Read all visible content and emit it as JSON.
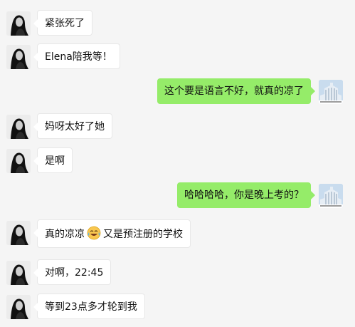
{
  "messages": [
    {
      "side": "left",
      "text": "紧张死了"
    },
    {
      "side": "left",
      "text": "Elena陪我等！"
    },
    {
      "side": "right",
      "text": "这个要是语言不好，就真的凉了"
    },
    {
      "side": "left",
      "text": "妈呀太好了她"
    },
    {
      "side": "left",
      "text": "是啊"
    },
    {
      "side": "right",
      "text": "哈哈哈哈，你是晚上考的？"
    },
    {
      "side": "left",
      "text_before": "真的凉凉",
      "emoji": "tears-of-joy-emoji",
      "text_after": "又是预注册的学校"
    },
    {
      "side": "left",
      "text": "对啊，22:45"
    },
    {
      "side": "left",
      "text": "等到23点多才轮到我"
    }
  ],
  "colors": {
    "background": "#f5f5f5",
    "left_bubble": "#ffffff",
    "right_bubble": "#95ec69",
    "text": "#111111"
  },
  "avatars": {
    "contact": "dark-portrait-avatar",
    "self": "building-photo-avatar"
  }
}
